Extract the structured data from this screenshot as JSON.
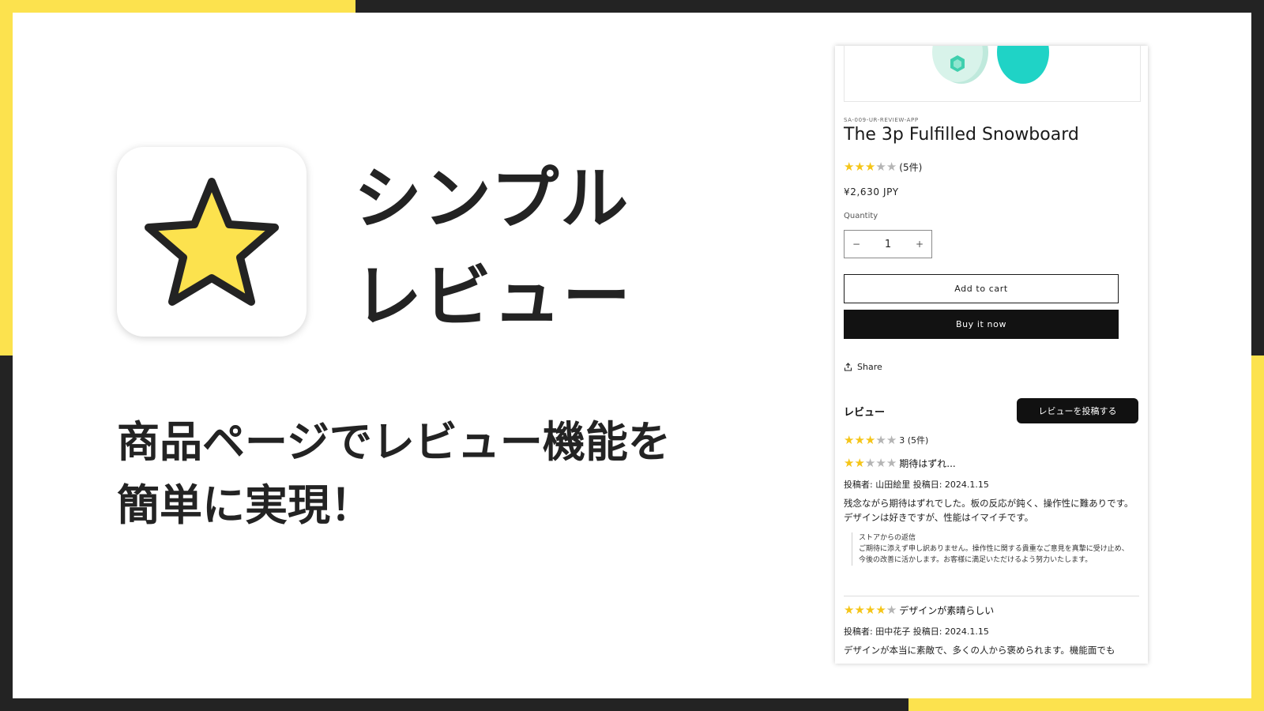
{
  "colors": {
    "accent": "#FCE24E",
    "dark": "#232323",
    "white": "#FFFFFF",
    "star_on": "#F5C518",
    "star_off": "#B5B5B5"
  },
  "promo": {
    "icon": "star-icon",
    "title_line1": "シンプル",
    "title_line2": "レビュー",
    "tagline_line1": "商品ページでレビュー機能を",
    "tagline_line2": "簡単に実現！"
  },
  "product": {
    "vendor": "SA-009-UR-REVIEW-APP",
    "title": "The 3p Fulfilled Snowboard",
    "rating_stars": 3,
    "rating_count": "(5件)",
    "price": "¥2,630 JPY",
    "quantity_label": "Quantity",
    "quantity_value": "1",
    "minus": "−",
    "plus": "+",
    "add_to_cart": "Add to cart",
    "buy_now": "Buy it now",
    "share": "Share"
  },
  "reviews": {
    "heading": "レビュー",
    "post_button": "レビューを投稿する",
    "summary_stars": 3,
    "summary_text": "3 (5件)",
    "items": [
      {
        "stars": 2,
        "title": "期待はずれ...",
        "meta": "投稿者: 山田絵里 投稿日: 2024.1.15",
        "body": "残念ながら期待はずれでした。板の反応が鈍く、操作性に難ありです。デザインは好きですが、性能はイマイチです。",
        "reply_title": "ストアからの返信",
        "reply_body": "ご期待に添えず申し訳ありません。操作性に関する貴重なご意見を真摯に受け止め、今後の改善に活かします。お客様に満足いただけるよう努力いたします。"
      },
      {
        "stars": 4,
        "title": "デザインが素晴らしい",
        "meta": "投稿者: 田中花子 投稿日: 2024.1.15",
        "body": "デザインが本当に素敵で、多くの人から褒められます。機能面でも"
      }
    ]
  }
}
